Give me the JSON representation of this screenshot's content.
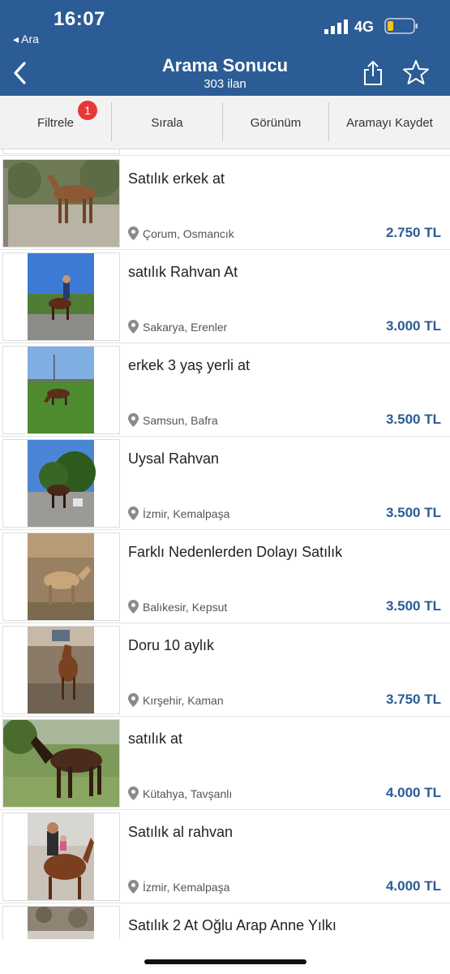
{
  "status": {
    "time": "16:07",
    "back_app": "◂ Ara",
    "network": "4G"
  },
  "nav": {
    "title": "Arama Sonucu",
    "subtitle": "303 ilan"
  },
  "toolbar": {
    "filter_label": "Filtrele",
    "filter_badge": "1",
    "sort_label": "Sırala",
    "view_label": "Görünüm",
    "save_label": "Aramayı Kaydet"
  },
  "listings": [
    {
      "title": "Satılık erkek at",
      "location": "Çorum, Osmancık",
      "price": "2.750 TL"
    },
    {
      "title": "satılık Rahvan At",
      "location": "Sakarya, Erenler",
      "price": "3.000 TL"
    },
    {
      "title": "erkek 3 yaş yerli at",
      "location": "Samsun, Bafra",
      "price": "3.500 TL"
    },
    {
      "title": "Uysal Rahvan",
      "location": "İzmir, Kemalpaşa",
      "price": "3.500 TL"
    },
    {
      "title": "Farklı Nedenlerden Dolayı Satılık",
      "location": "Balıkesir, Kepsut",
      "price": "3.500 TL"
    },
    {
      "title": "Doru 10 aylık",
      "location": "Kırşehir, Kaman",
      "price": "3.750 TL"
    },
    {
      "title": "satılık at",
      "location": "Kütahya, Tavşanlı",
      "price": "4.000 TL"
    },
    {
      "title": "Satılık al rahvan",
      "location": "İzmir, Kemalpaşa",
      "price": "4.000 TL"
    },
    {
      "title": "Satılık 2 At Oğlu Arap Anne Yılkı",
      "location": "",
      "price": ""
    }
  ],
  "colors": {
    "header": "#2b5c96",
    "price": "#2b5c96",
    "badge": "#e53935"
  }
}
